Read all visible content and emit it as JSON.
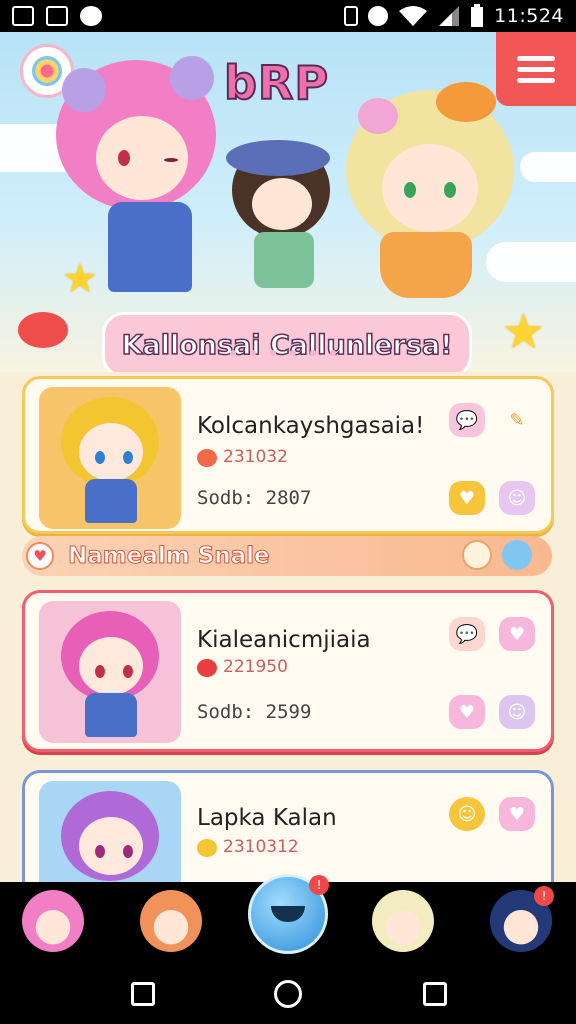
{
  "status_bar": {
    "time": "11:524",
    "icons": [
      "gallery-icon",
      "image-icon",
      "heart-notification-icon",
      "vibrate-icon",
      "alarm-icon",
      "wifi-icon",
      "signal-icon",
      "battery-icon"
    ]
  },
  "hero": {
    "brand": "bRP",
    "banner": "Kallonsai Callunlersa!",
    "menu_icon": "hamburger-menu-icon"
  },
  "cards": [
    {
      "title": "Kolcankayshgasaia!",
      "subtitle": "231032",
      "score": "Sodb: 2807",
      "accent": "#f5c85a"
    },
    {
      "title": "Kialeanicmjiaia",
      "subtitle": "221950",
      "score": "Sodb: 2599",
      "accent": "#f05d6d"
    },
    {
      "title": "Lapka Kalan",
      "subtitle": "2310312",
      "score": "",
      "accent": "#7a96d6"
    }
  ],
  "section": {
    "label": "Namealm Snale"
  },
  "colors": {
    "menu_red": "#f25656",
    "brand_pink": "#f06fae",
    "gold_border": "#f5c85a",
    "pink_border": "#f05d6d",
    "blue_border": "#7a96d6",
    "dock_center": "#2f8ed8"
  }
}
